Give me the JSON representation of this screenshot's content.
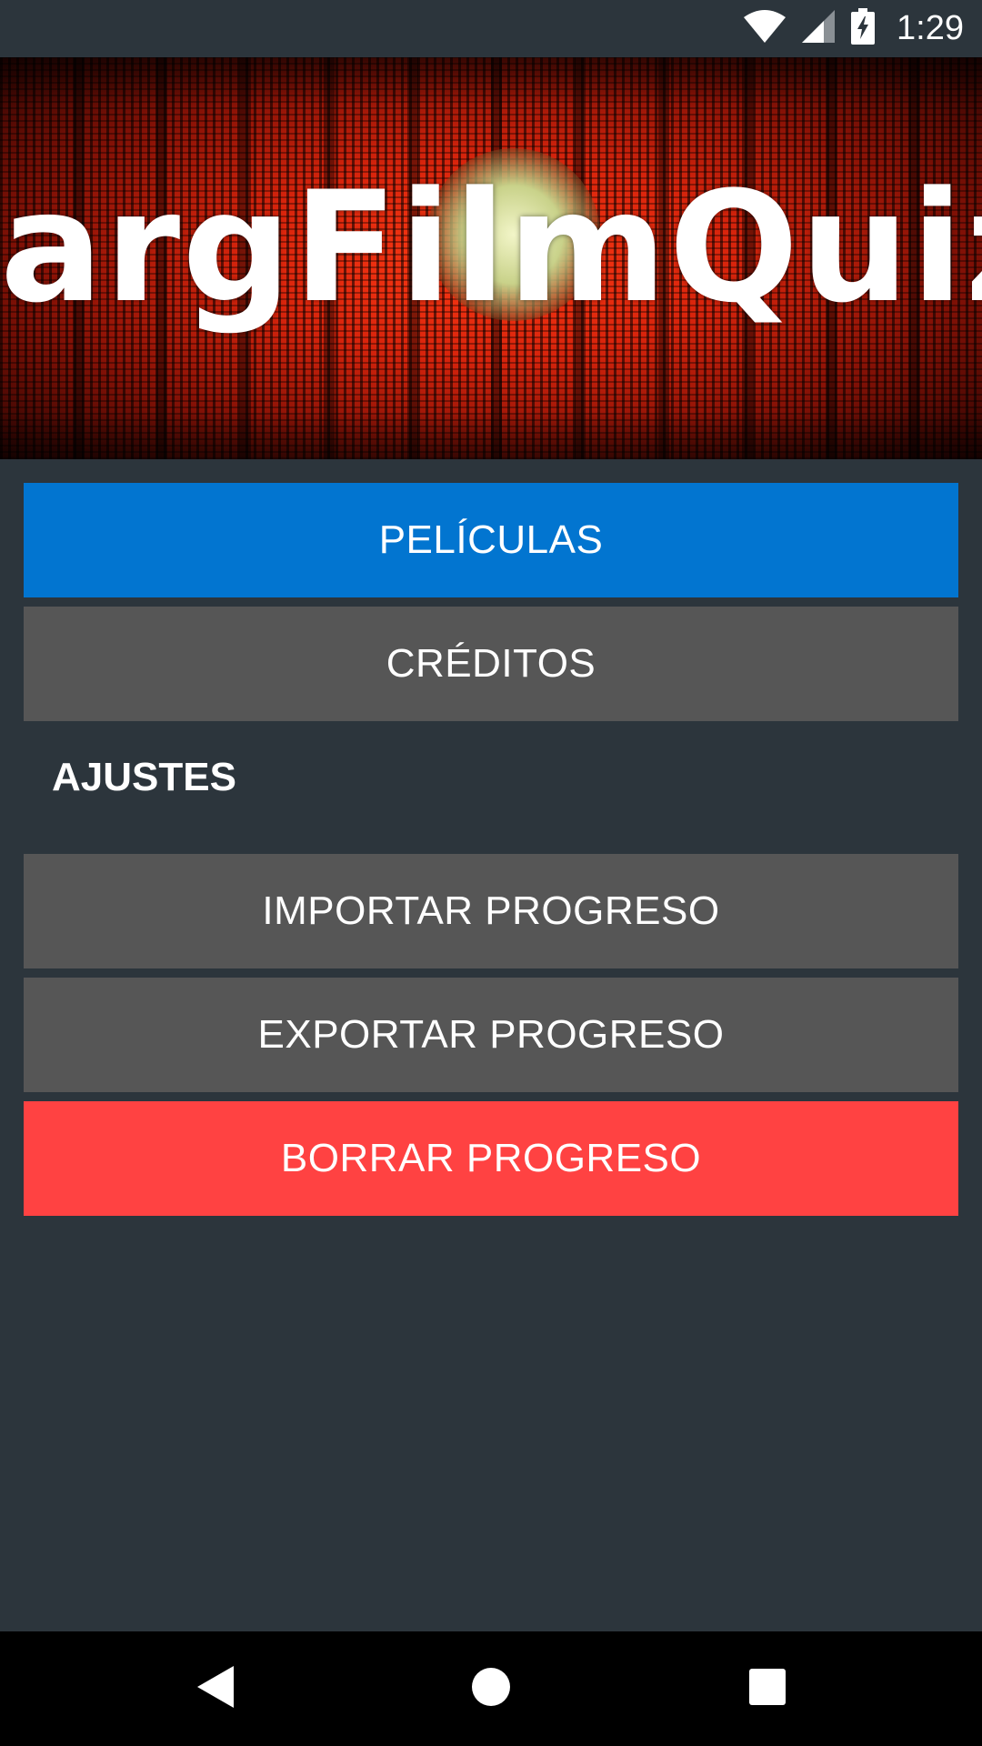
{
  "status_bar": {
    "time": "1:29",
    "icons": [
      "wifi-icon",
      "cell-signal-icon",
      "battery-charging-icon"
    ]
  },
  "banner": {
    "title": "argFilmQuiz"
  },
  "menu": {
    "peliculas_label": "PELÍCULAS",
    "creditos_label": "CRÉDITOS"
  },
  "settings": {
    "title": "AJUSTES",
    "importar_label": "IMPORTAR PROGRESO",
    "exportar_label": "EXPORTAR PROGRESO",
    "borrar_label": "BORRAR PROGRESO"
  },
  "nav_bar": {
    "icons": [
      "back-icon",
      "home-icon",
      "recents-icon"
    ]
  },
  "colors": {
    "background": "#2c353c",
    "primary_button": "#0275d0",
    "secondary_button": "#565656",
    "danger_button": "#ff4242"
  }
}
